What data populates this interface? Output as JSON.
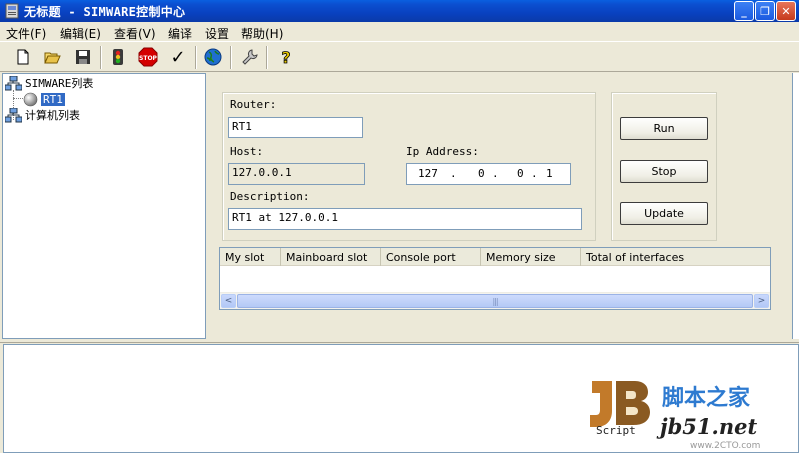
{
  "window": {
    "title": "无标题 - SIMWARE控制中心",
    "buttons": {
      "minimize": "_",
      "maximize": "❐",
      "close": "✕"
    }
  },
  "menu": [
    "文件(F)",
    "编辑(E)",
    "查看(V)",
    "编译",
    "设置",
    "帮助(H)"
  ],
  "toolbar": {
    "icons": [
      "new-file-icon",
      "open-folder-icon",
      "save-icon",
      "traffic-light-icon",
      "stop-icon",
      "checkmark-icon",
      "globe-icon",
      "wrench-icon",
      "help-icon"
    ],
    "stop_text": "STOP",
    "check_glyph": "✓",
    "help_glyph": "?"
  },
  "tree": {
    "root1": "SIMWARE列表",
    "child1": "RT1",
    "root2": "计算机列表"
  },
  "form": {
    "router_label": "Router:",
    "router_value": "RT1",
    "host_label": "Host:",
    "host_value": "127.0.0.1",
    "ip_label": "Ip Address:",
    "ip": [
      "127",
      ".",
      "0",
      ".",
      "0",
      ".",
      "1"
    ],
    "description_label": "Description:",
    "description_value": "RT1 at 127.0.0.1"
  },
  "buttons": {
    "run": "Run",
    "stop": "Stop",
    "update": "Update"
  },
  "list": {
    "columns": [
      "My slot",
      "Mainboard slot",
      "Console port",
      "Memory size",
      "Total of interfaces"
    ],
    "rows": [],
    "scroll_left": "<",
    "scroll_right": ">",
    "thumb_grip": "|||"
  },
  "watermark": {
    "logo_text": "Script",
    "cn_text": "脚本之家",
    "url": "jb51.net",
    "url2": "www.2CTO.com"
  },
  "colors": {
    "titlebar": "#0a4ad0",
    "selection": "#316ac5",
    "face": "#ece9d8",
    "stop": "#d40000",
    "watermark_blue": "#2d7ad0"
  }
}
